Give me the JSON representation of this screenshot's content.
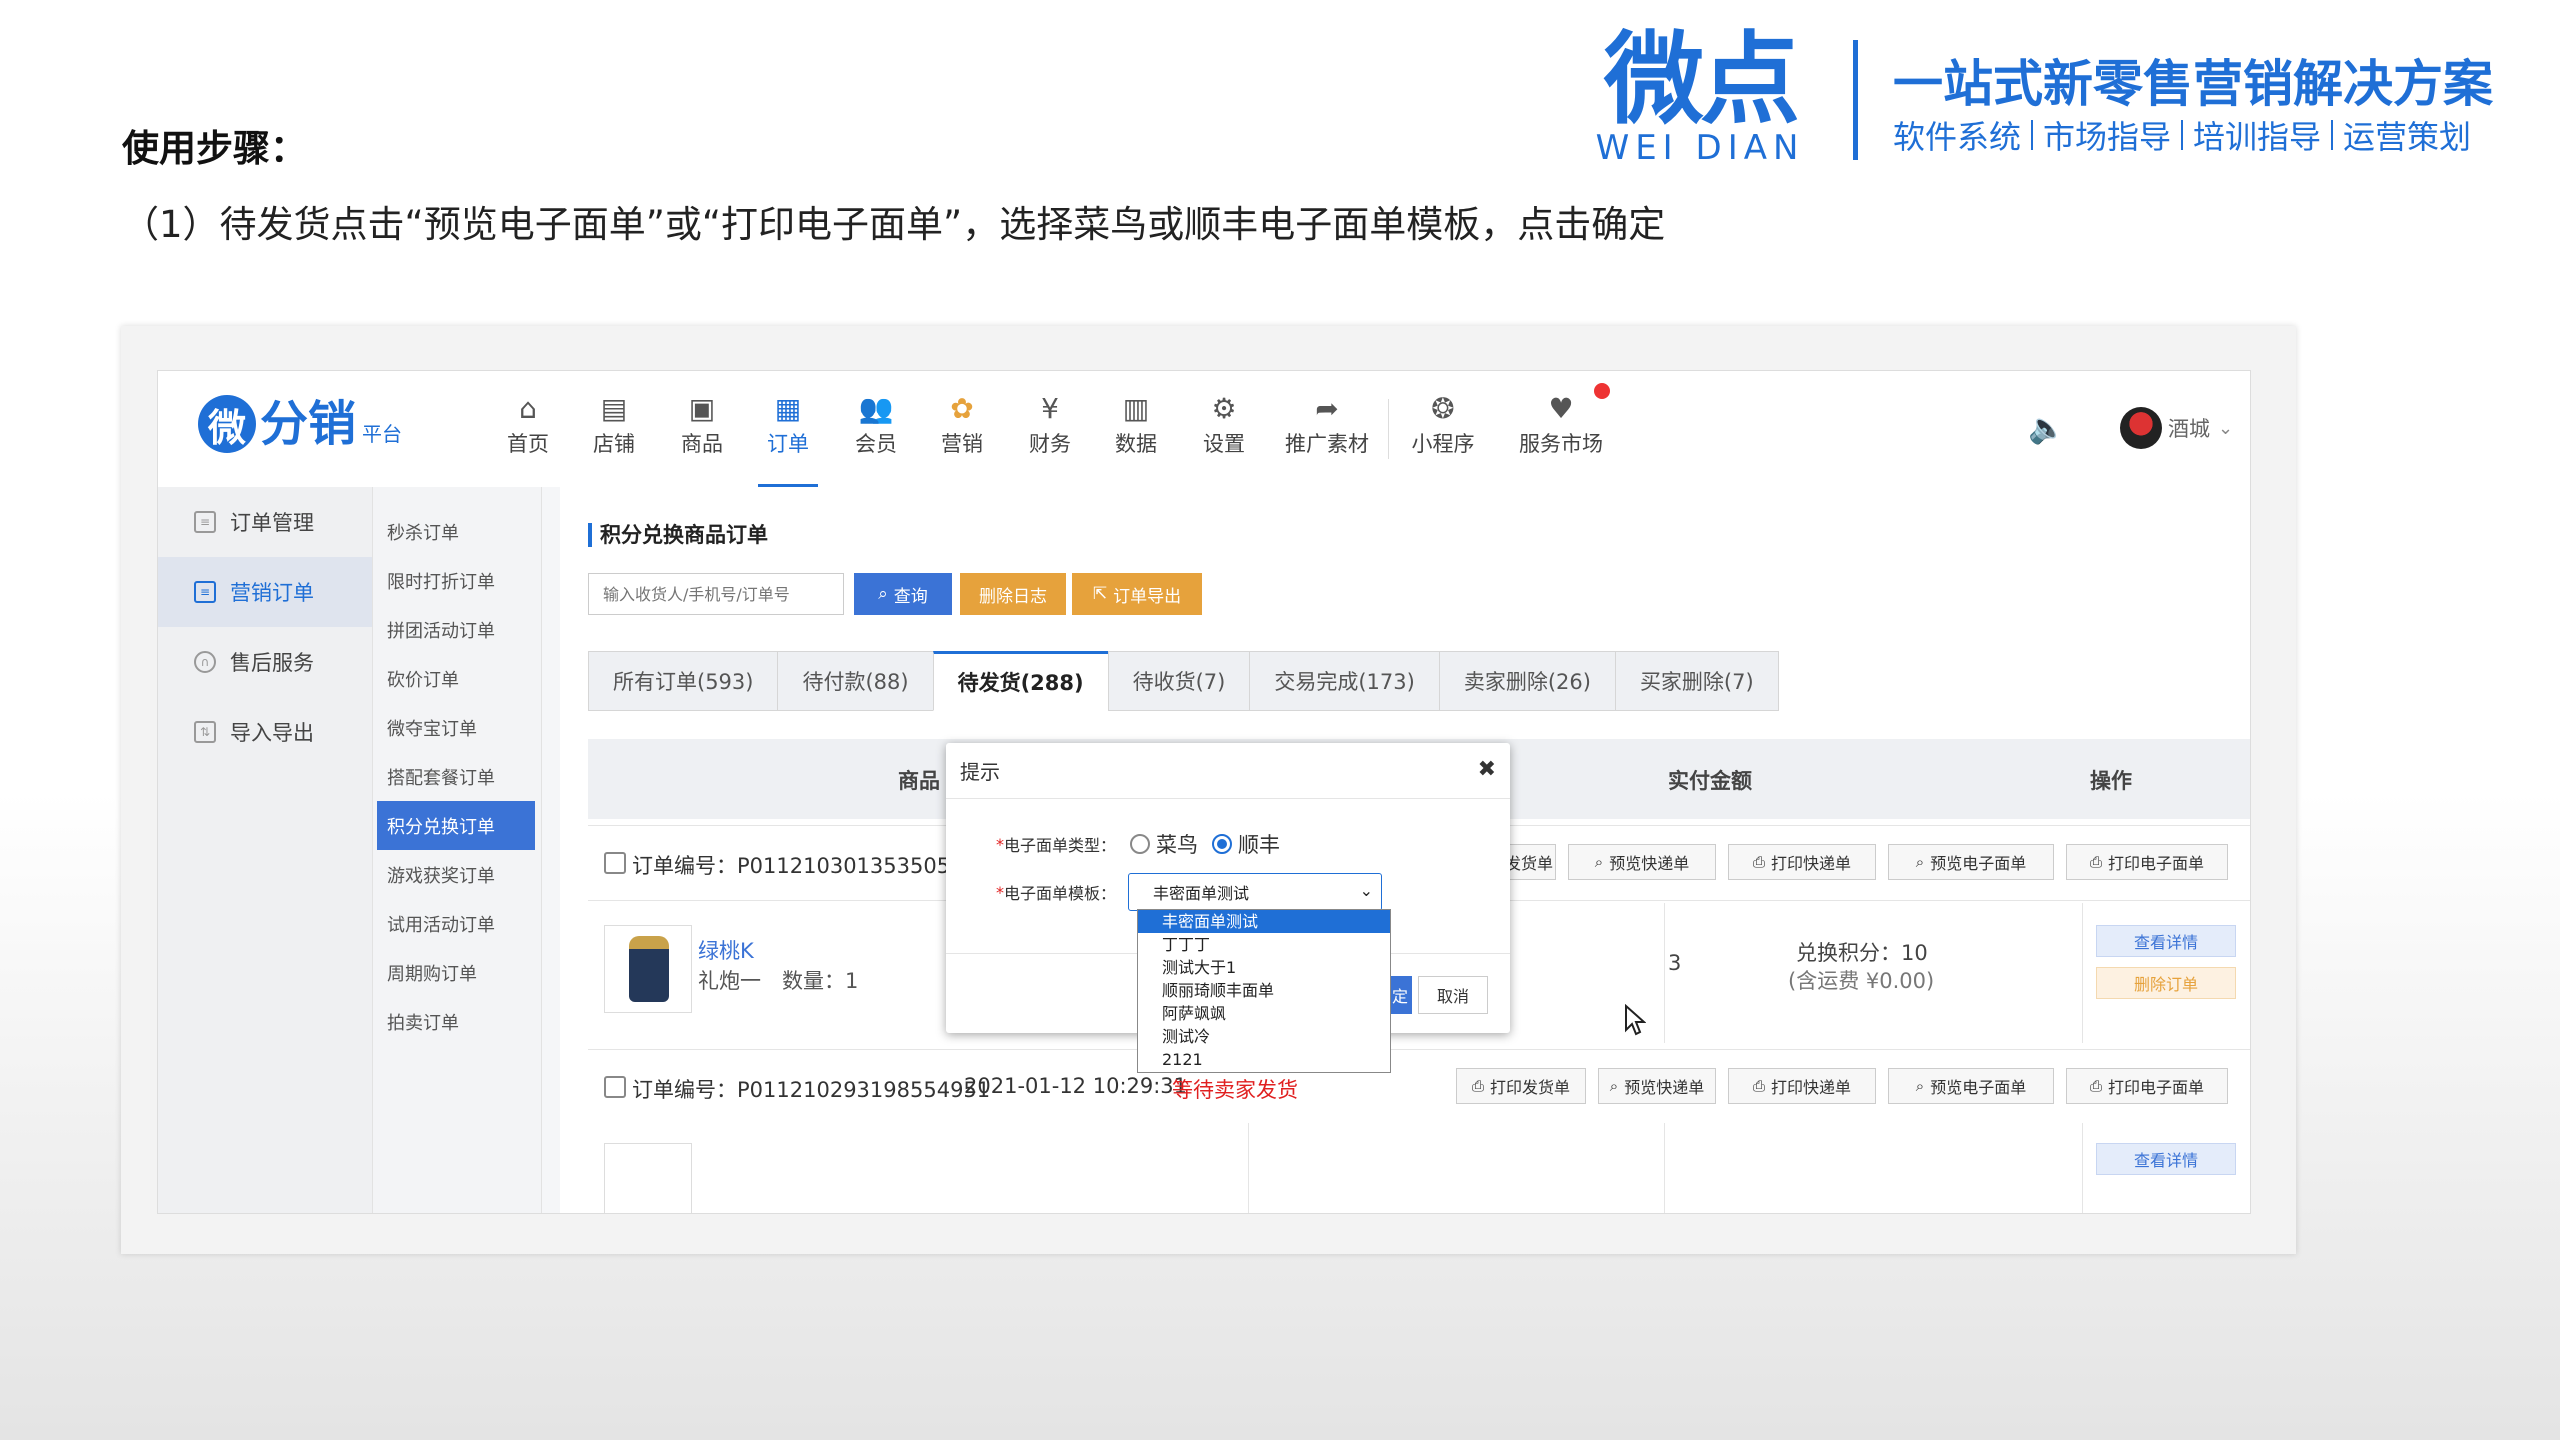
{
  "slide": {
    "steps_title": "使用步骤：",
    "steps_desc": "（1）待发货点击“预览电子面单”或“打印电子面单”，选择菜鸟或顺丰电子面单模板，点击确定"
  },
  "brand": {
    "logo_cn": "微点",
    "logo_en": "WEI DIAN",
    "slogan": "一站式新零售营销解决方案",
    "services": [
      "软件系统",
      "市场指导",
      "培训指导",
      "运营策划"
    ],
    "color": "#1f6fd6"
  },
  "app": {
    "logo_mark": "微",
    "logo_text": "分销",
    "logo_sub": "平台",
    "nav": [
      {
        "label": "首页",
        "icon": "home-icon",
        "glyph": "⌂"
      },
      {
        "label": "店铺",
        "icon": "store-icon",
        "glyph": "▤"
      },
      {
        "label": "商品",
        "icon": "goods-icon",
        "glyph": "▣"
      },
      {
        "label": "订单",
        "icon": "order-icon",
        "glyph": "▦"
      },
      {
        "label": "会员",
        "icon": "member-icon",
        "glyph": "👥"
      },
      {
        "label": "营销",
        "icon": "marketing-icon",
        "glyph": "✿"
      },
      {
        "label": "财务",
        "icon": "finance-icon",
        "glyph": "¥"
      },
      {
        "label": "数据",
        "icon": "data-icon",
        "glyph": "▥"
      },
      {
        "label": "设置",
        "icon": "settings-icon",
        "glyph": "⚙"
      },
      {
        "label": "推广素材",
        "icon": "share-icon",
        "glyph": "➦"
      },
      {
        "label": "小程序",
        "icon": "miniapp-icon",
        "glyph": "❂"
      },
      {
        "label": "服务市场",
        "icon": "market-icon",
        "glyph": "♥"
      }
    ],
    "user_name": "酒城",
    "sidebar1": [
      {
        "label": "订单管理",
        "icon": "order-manage-icon"
      },
      {
        "label": "营销订单",
        "icon": "marketing-order-icon"
      },
      {
        "label": "售后服务",
        "icon": "after-sale-icon"
      },
      {
        "label": "导入导出",
        "icon": "import-export-icon"
      }
    ],
    "sidebar2": [
      "秒杀订单",
      "限时打折订单",
      "拼团活动订单",
      "砍价订单",
      "微夺宝订单",
      "搭配套餐订单",
      "积分兑换订单",
      "游戏获奖订单",
      "试用活动订单",
      "周期购订单",
      "拍卖订单"
    ],
    "section_title": "积分兑换商品订单",
    "search_placeholder": "输入收货人/手机号/订单号",
    "btn_query": "查询",
    "btn_delete_log": "删除日志",
    "btn_export": "订单导出",
    "tabs": [
      "所有订单(593)",
      "待付款(88)",
      "待发货(288)",
      "待收货(7)",
      "交易完成(173)",
      "卖家删除(26)",
      "买家删除(7)"
    ],
    "table_headers": {
      "goods": "商品",
      "paid": "实付金额",
      "ops": "操作"
    },
    "order_buttons": [
      "打印发货单",
      "预览快递单",
      "打印快递单",
      "预览电子面单",
      "打印电子面单"
    ],
    "orders": [
      {
        "no_label": "订单编号：P011210301353505551"
      },
      {
        "no_label": "订单编号：P011210293198554951",
        "time": "2021-01-12 10:29:31",
        "status": "等待卖家发货"
      }
    ],
    "goods": {
      "name": "绿桃K",
      "spec": "礼炮一　数量：1",
      "points": "兑换积分：10",
      "fee": "(含运费 ¥0.00)",
      "clipped_tail": "3"
    },
    "btn_view_detail": "查看详情",
    "btn_delete_order": "删除订单"
  },
  "dialog": {
    "title": "提示",
    "type_label": "电子面单类型：",
    "template_label": "电子面单模板：",
    "required_mark": "*",
    "radio_options": [
      "菜鸟",
      "顺丰"
    ],
    "radio_selected": "顺丰",
    "selected_template": "丰密面单测试",
    "ok_label": "定",
    "cancel_label": "取消",
    "template_options": [
      "丰密面单测试",
      "丁丁丁",
      "测试大于1",
      "顺丽琦顺丰面单",
      "阿萨飒飒",
      "测试冷",
      "2121"
    ]
  }
}
